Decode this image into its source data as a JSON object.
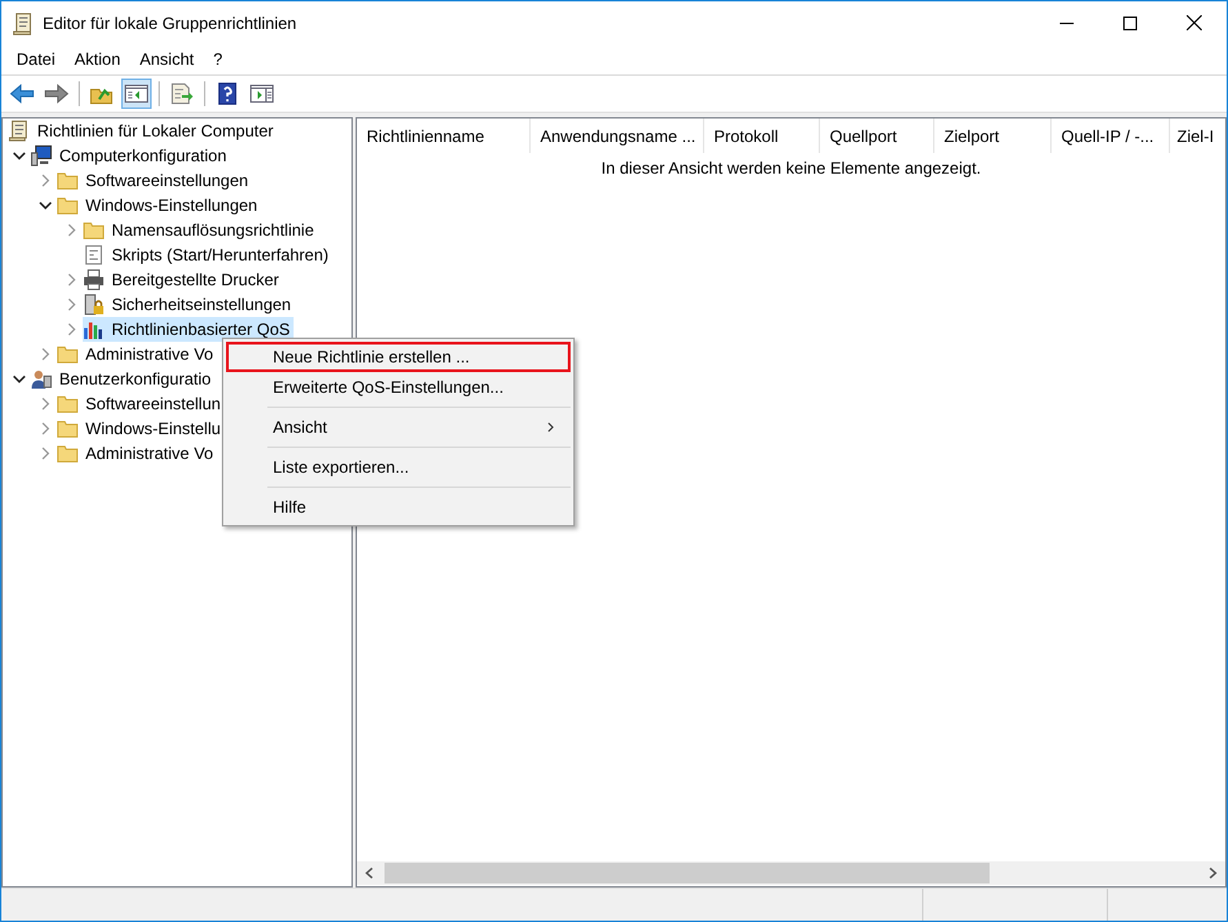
{
  "window": {
    "title": "Editor für lokale Gruppenrichtlinien"
  },
  "menu_bar": [
    "Datei",
    "Aktion",
    "Ansicht",
    "?"
  ],
  "toolbar": [
    {
      "kind": "back",
      "pressed": false
    },
    {
      "kind": "forward",
      "pressed": false
    },
    {
      "kind": "separator"
    },
    {
      "kind": "up",
      "pressed": false
    },
    {
      "kind": "tree-toggle",
      "pressed": true
    },
    {
      "kind": "separator"
    },
    {
      "kind": "export",
      "pressed": false
    },
    {
      "kind": "separator"
    },
    {
      "kind": "help",
      "pressed": false
    },
    {
      "kind": "action-pane",
      "pressed": false
    }
  ],
  "tree": [
    {
      "label": "Richtlinien für Lokaler Computer",
      "kind": "scroll",
      "selected": false,
      "children": [
        {
          "label": "Computerkonfiguration",
          "kind": "computer",
          "expanded": true,
          "selected": false,
          "children": [
            {
              "label": "Softwareeinstellungen",
              "kind": "folder",
              "expanded": false,
              "selected": false
            },
            {
              "label": "Windows-Einstellungen",
              "kind": "folder",
              "expanded": true,
              "selected": false,
              "children": [
                {
                  "label": "Namensauflösungsrichtlinie",
                  "kind": "folder",
                  "expanded": false,
                  "selected": false
                },
                {
                  "label": "Skripts (Start/Herunterfahren)",
                  "kind": "script",
                  "selected": false
                },
                {
                  "label": "Bereitgestellte Drucker",
                  "kind": "printer",
                  "expanded": false,
                  "selected": false
                },
                {
                  "label": "Sicherheitseinstellungen",
                  "kind": "security",
                  "expanded": false,
                  "selected": false
                },
                {
                  "label": "Richtlinienbasierter QoS",
                  "kind": "chart",
                  "expanded": false,
                  "selected": true
                }
              ]
            },
            {
              "label": "Administrative Vo",
              "kind": "folder",
              "expanded": false,
              "selected": false
            }
          ]
        },
        {
          "label": "Benutzerkonfiguratio",
          "kind": "user",
          "expanded": true,
          "selected": false,
          "children": [
            {
              "label": "Softwareeinstellun",
              "kind": "folder",
              "expanded": false,
              "selected": false
            },
            {
              "label": "Windows-Einstellu",
              "kind": "folder",
              "expanded": false,
              "selected": false
            },
            {
              "label": "Administrative Vo",
              "kind": "folder",
              "expanded": false,
              "selected": false
            }
          ]
        }
      ]
    }
  ],
  "list": {
    "columns": [
      "Richtlinienname",
      "Anwendungsname ...",
      "Protokoll",
      "Quellport",
      "Zielport",
      "Quell-IP / -...",
      "Ziel-I"
    ],
    "empty_message": "In dieser Ansicht werden keine Elemente angezeigt."
  },
  "context_menu": [
    {
      "kind": "item",
      "label": "Neue Richtlinie erstellen ...",
      "highlighted": true,
      "submenu": false
    },
    {
      "kind": "item",
      "label": "Erweiterte QoS-Einstellungen...",
      "highlighted": false,
      "submenu": false
    },
    {
      "kind": "separator"
    },
    {
      "kind": "item",
      "label": "Ansicht",
      "highlighted": false,
      "submenu": true
    },
    {
      "kind": "separator"
    },
    {
      "kind": "item",
      "label": "Liste exportieren...",
      "highlighted": false,
      "submenu": false
    },
    {
      "kind": "separator"
    },
    {
      "kind": "item",
      "label": "Hilfe",
      "highlighted": false,
      "submenu": false
    }
  ]
}
